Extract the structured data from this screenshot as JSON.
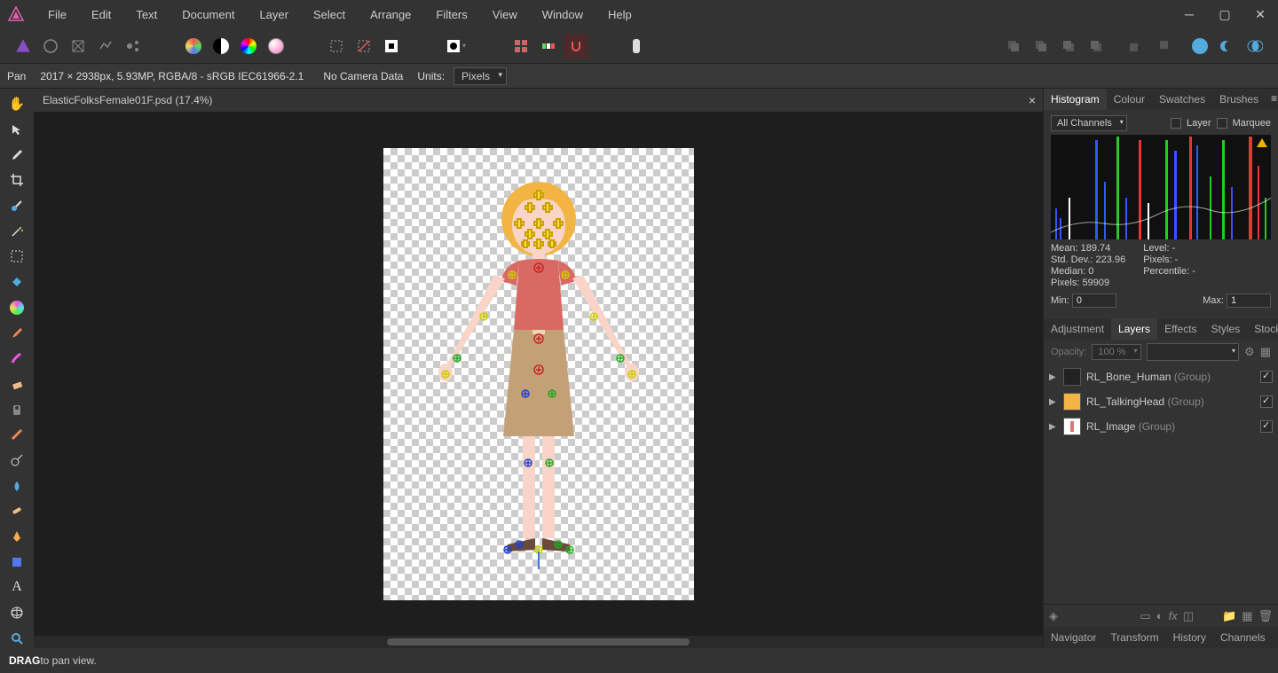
{
  "menubar": {
    "items": [
      "File",
      "Edit",
      "Text",
      "Document",
      "Layer",
      "Select",
      "Arrange",
      "Filters",
      "View",
      "Window",
      "Help"
    ]
  },
  "contextbar": {
    "tool": "Pan",
    "doc_info": "2017 × 2938px, 5.93MP, RGBA/8 - sRGB IEC61966-2.1",
    "camera": "No Camera Data",
    "units_label": "Units:",
    "units_value": "Pixels"
  },
  "document": {
    "tab_title": "ElasticFolksFemale01F.psd (17.4%)"
  },
  "panels": {
    "top_tabs": [
      "Histogram",
      "Colour",
      "Swatches",
      "Brushes"
    ],
    "histogram": {
      "channel": "All Channels",
      "layer_label": "Layer",
      "marquee_label": "Marquee",
      "mean_label": "Mean:",
      "mean": "189.74",
      "std_label": "Std. Dev.:",
      "std": "223.96",
      "median_label": "Median:",
      "median": "0",
      "pixels_label": "Pixels:",
      "pixels": "59909",
      "level_label": "Level:",
      "level": "-",
      "count_label": "Pixels:",
      "count": "-",
      "perc_label": "Percentile:",
      "perc": "-",
      "min_label": "Min:",
      "min": "0",
      "max_label": "Max:",
      "max": "1"
    },
    "mid_tabs": [
      "Adjustment",
      "Layers",
      "Effects",
      "Styles",
      "Stock"
    ],
    "layers": {
      "opacity_label": "Opacity:",
      "opacity_value": "100 %",
      "items": [
        {
          "name": "RL_Bone_Human",
          "type": "(Group)"
        },
        {
          "name": "RL_TalkingHead",
          "type": "(Group)"
        },
        {
          "name": "RL_Image",
          "type": "(Group)"
        }
      ]
    },
    "bottom_tabs": [
      "Navigator",
      "Transform",
      "History",
      "Channels"
    ]
  },
  "statusbar": {
    "bold": "DRAG",
    "rest": " to pan view."
  }
}
